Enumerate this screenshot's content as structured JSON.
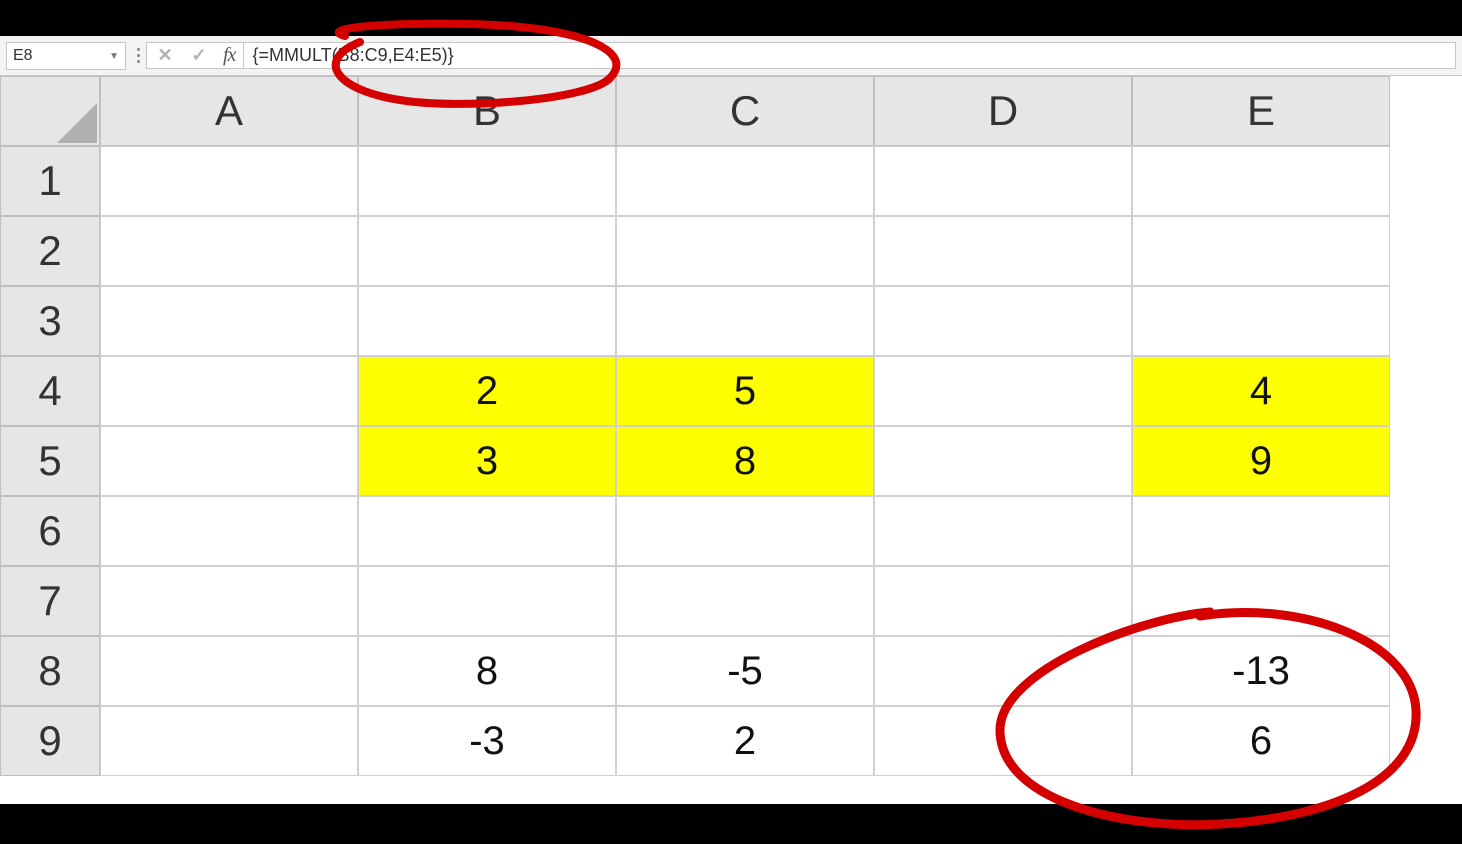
{
  "name_box": {
    "value": "E8"
  },
  "formula_bar": {
    "formula": "{=MMULT(B8:C9,E4:E5)}",
    "fx_label": "fx"
  },
  "icons": {
    "cancel": "✕",
    "confirm": "✓",
    "dropdown": "▼"
  },
  "columns": [
    "A",
    "B",
    "C",
    "D",
    "E"
  ],
  "rows": [
    "1",
    "2",
    "3",
    "4",
    "5",
    "6",
    "7",
    "8",
    "9"
  ],
  "cells": {
    "B4": "2",
    "C4": "5",
    "E4": "4",
    "B5": "3",
    "C5": "8",
    "E5": "9",
    "B8": "8",
    "C8": "-5",
    "E8": "-13",
    "B9": "-3",
    "C9": "2",
    "E9": "6"
  },
  "highlighted": [
    "B4",
    "C4",
    "B5",
    "C5",
    "E4",
    "E5"
  ],
  "annotation": {
    "color": "#d40000",
    "circles": [
      {
        "target": "formula-bar"
      },
      {
        "target": "result-E8-E9"
      }
    ]
  }
}
